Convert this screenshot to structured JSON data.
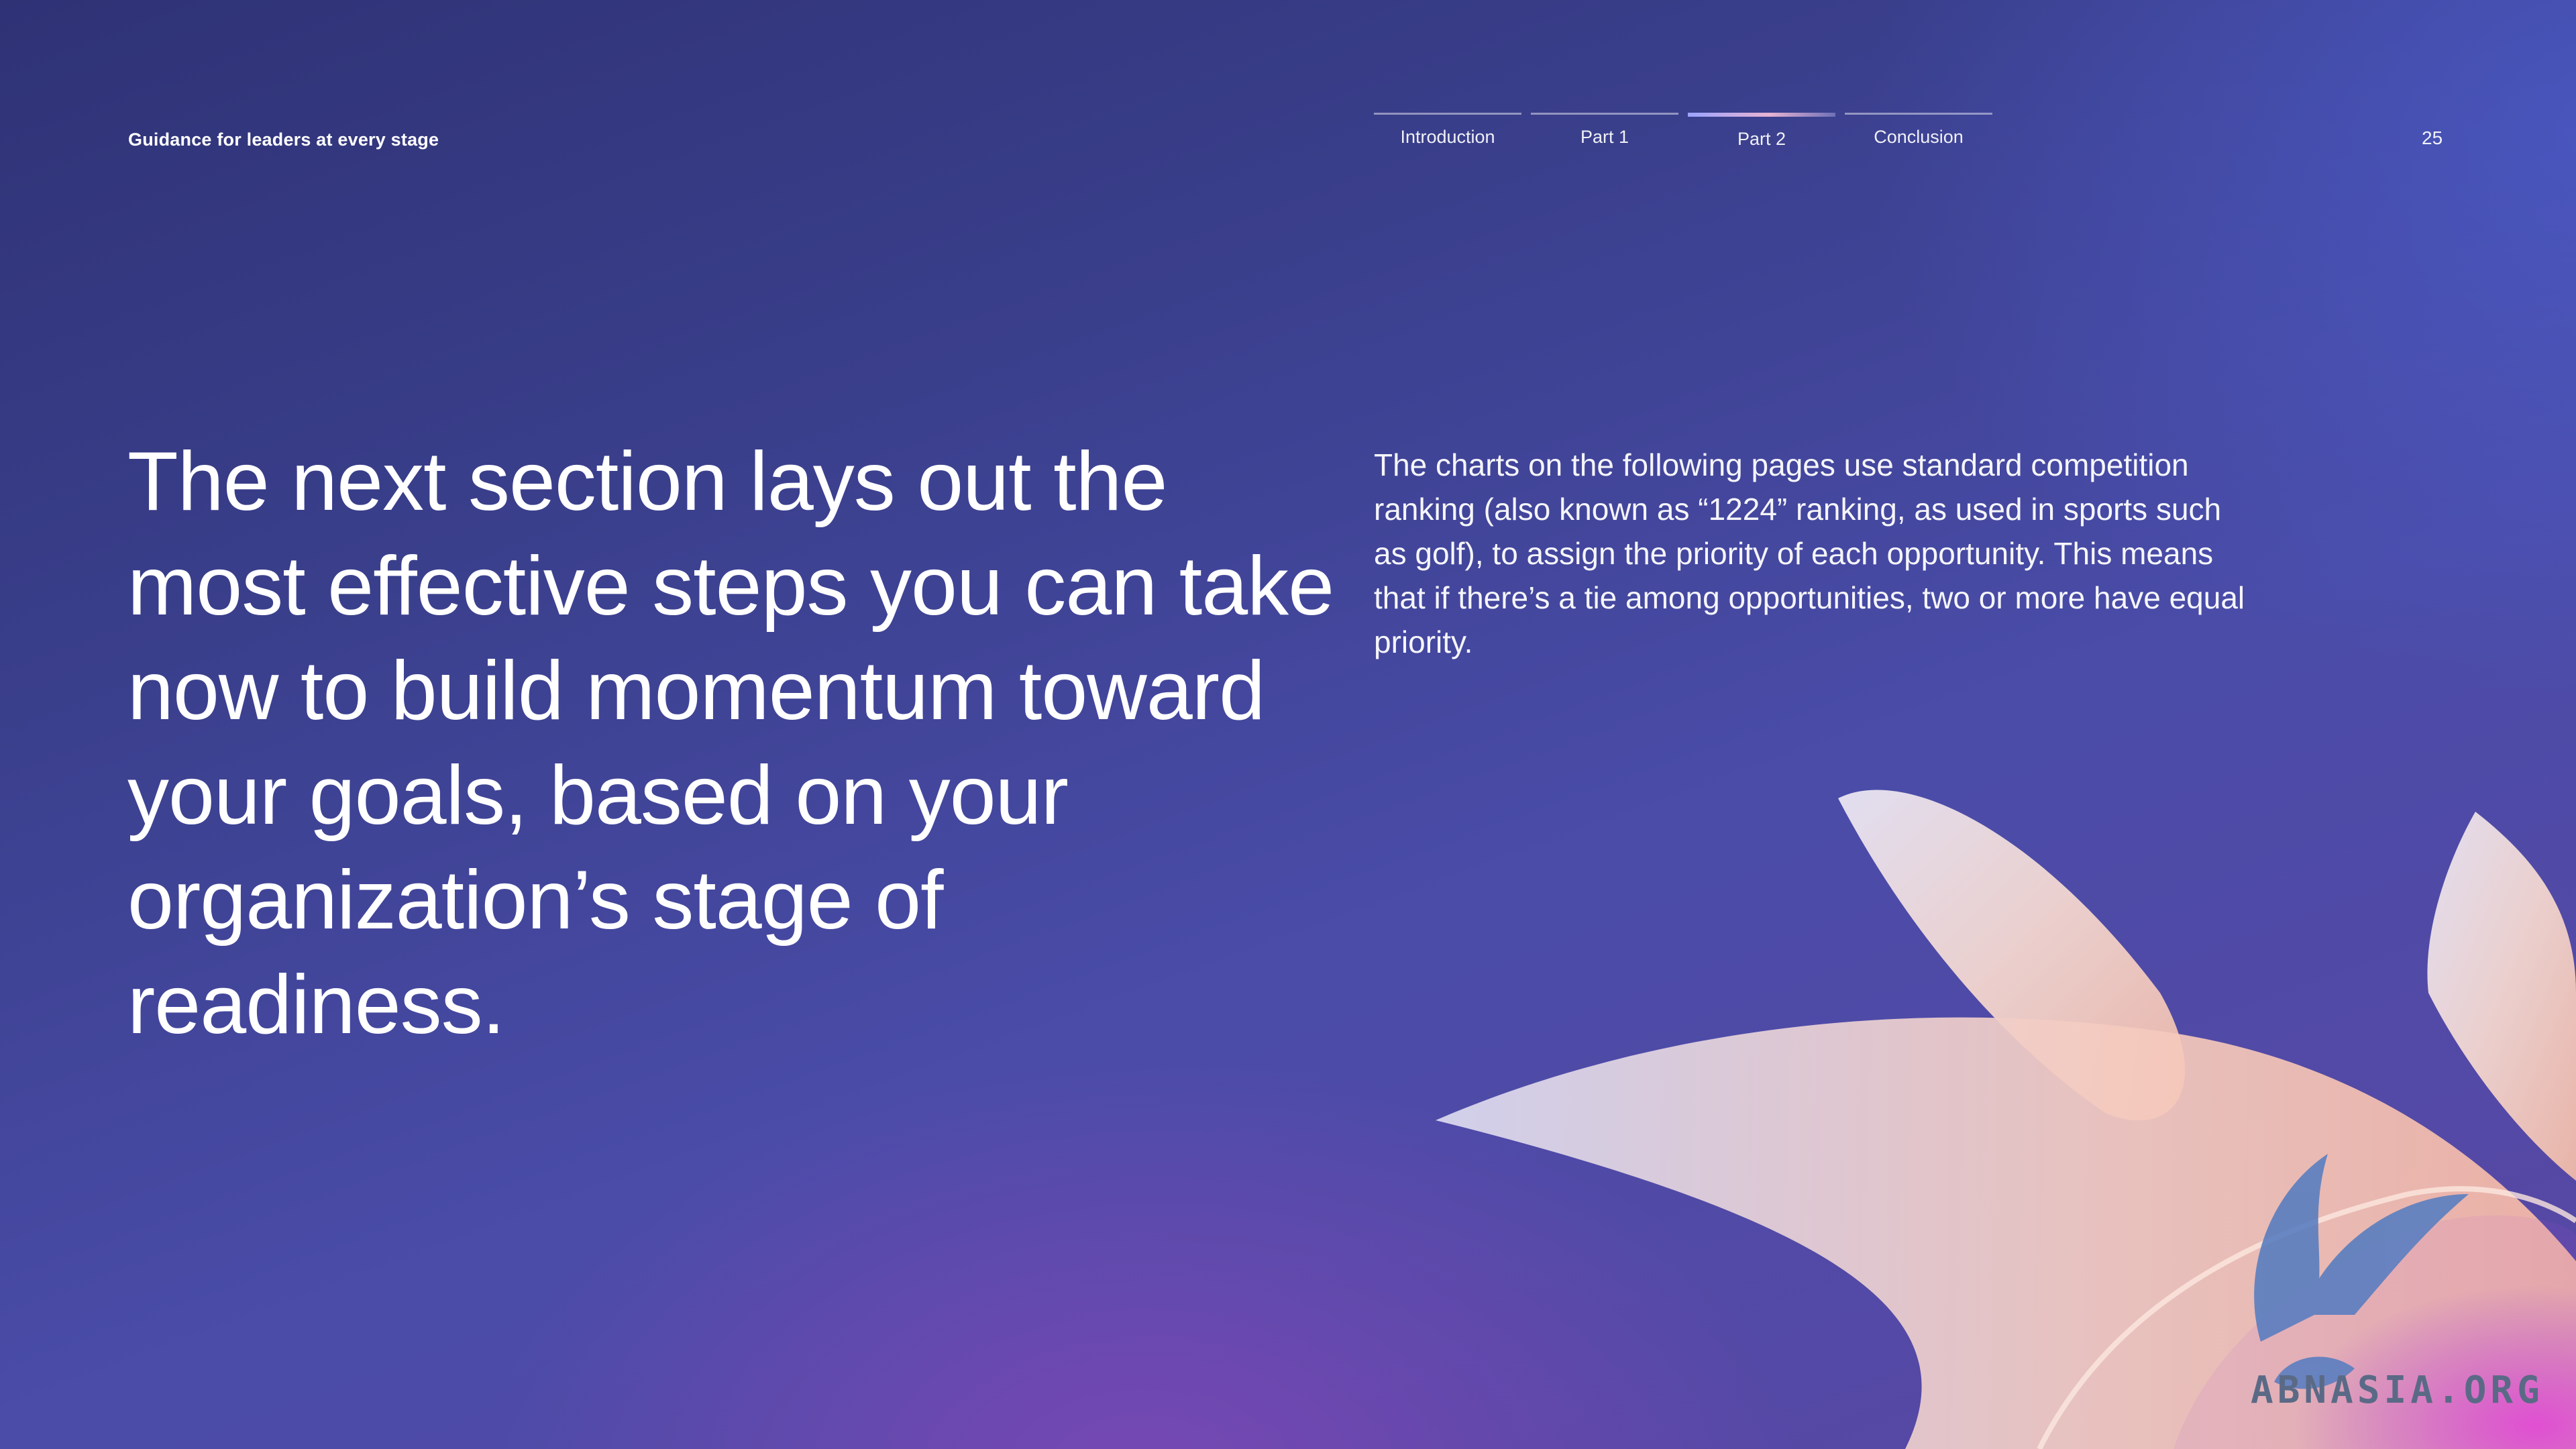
{
  "header": {
    "document_title": "Guidance for leaders at every stage",
    "page_number": "25"
  },
  "nav": {
    "tabs": [
      {
        "label": "Introduction",
        "active": false
      },
      {
        "label": "Part 1",
        "active": false
      },
      {
        "label": "Part 2",
        "active": true
      },
      {
        "label": "Conclusion",
        "active": false
      }
    ]
  },
  "main": {
    "headline": "The next section lays out the most effective steps you can take now to build momentum toward your goals, based on your organization’s stage of readiness.",
    "body": "The charts on the following pages use standard competition ranking (also known as “1224” ranking, as used in sports such as golf), to assign the priority of each opportunity. This means that if there’s a tie among opportunities, two or more have equal priority."
  },
  "watermark": {
    "text": "ABNASIA.ORG"
  },
  "colors": {
    "background_top": "#2f3275",
    "background_bottom": "#5a47a4",
    "petal_light": "#f3d8cf",
    "petal_pink": "#d957c9"
  }
}
